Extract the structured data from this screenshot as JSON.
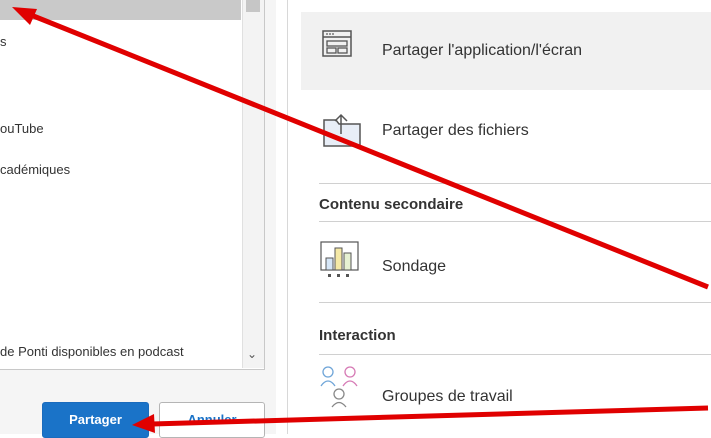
{
  "left_list": {
    "items": [
      {
        "text": "s"
      },
      {
        "text": "ouTube"
      },
      {
        "text": "cadémiques"
      },
      {
        "text": "de Ponti disponibles en podcast"
      }
    ]
  },
  "buttons": {
    "share": "Partager",
    "cancel": "Annuler"
  },
  "share_options": {
    "app_screen": "Partager l'application/l'écran",
    "files": "Partager des fichiers"
  },
  "sections": {
    "secondary_content": "Contenu secondaire",
    "poll": "Sondage",
    "interaction": "Interaction",
    "breakout": "Groupes de travail"
  },
  "icons": {
    "app_screen": "window-icon",
    "files": "folder-upload-icon",
    "poll": "bar-chart-icon",
    "breakout": "people-group-icon",
    "scroll": "chevron-down-icon"
  },
  "colors": {
    "primary": "#1a73c8",
    "annotation_arrow": "#e00000",
    "selected_row": "#c9c9c9",
    "highlight_row": "#f1f1f1"
  }
}
